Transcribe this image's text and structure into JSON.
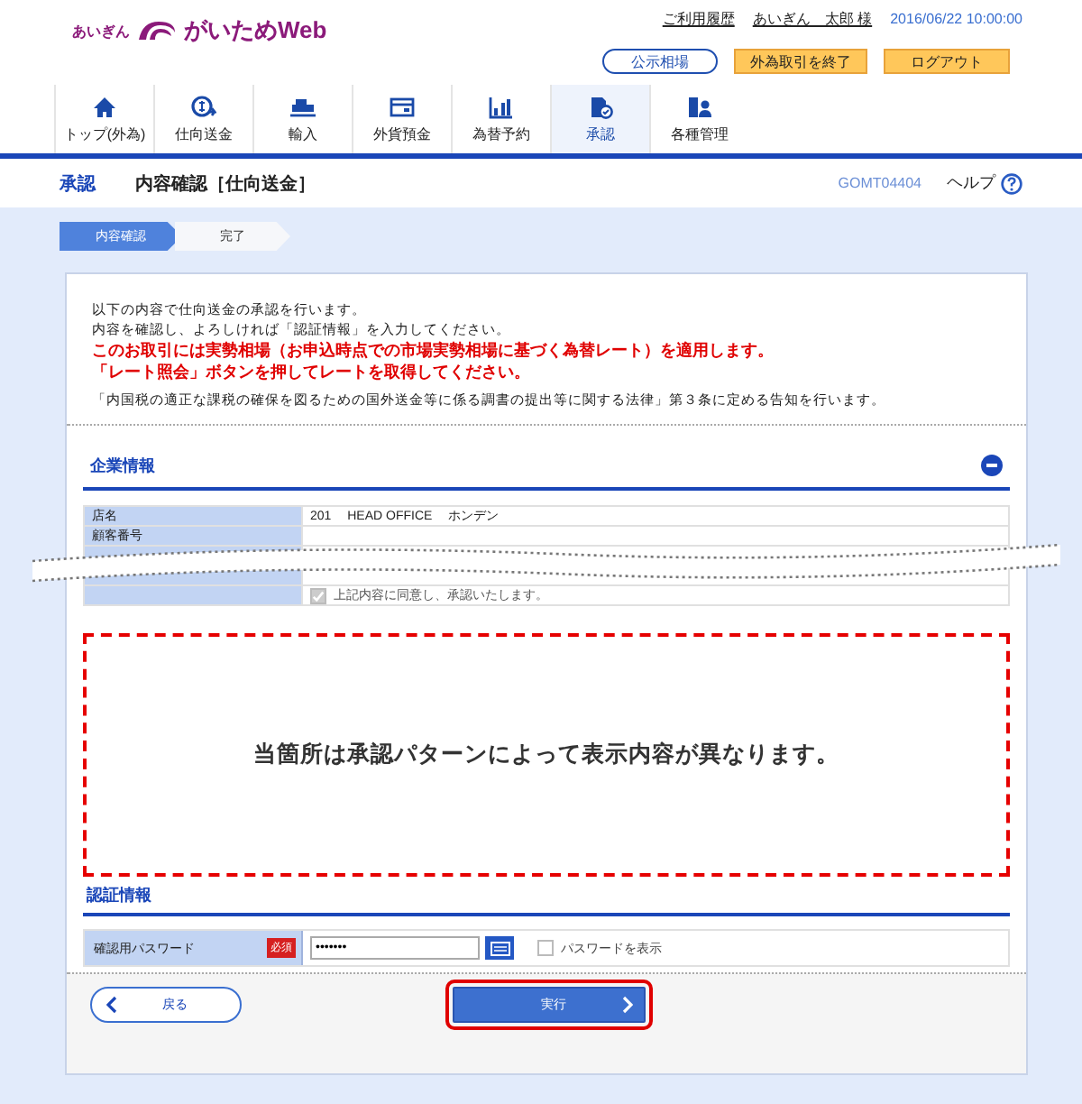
{
  "header": {
    "logo_small": "あいぎん",
    "logo": "がいためWeb",
    "links": [
      "ご利用履歴",
      "あいぎん　太郎 様"
    ],
    "datetime": "2016/06/22 10:00:00",
    "buttons": [
      {
        "label": "公示相場",
        "kind": "outline"
      },
      {
        "label": "外為取引を終了",
        "kind": "orange"
      },
      {
        "label": "ログアウト",
        "kind": "orange"
      }
    ]
  },
  "nav": [
    {
      "label": "トップ(外為)",
      "kind": "home",
      "selected": false
    },
    {
      "label": "仕向送金",
      "kind": "remit",
      "selected": false
    },
    {
      "label": "輸入",
      "kind": "ship",
      "selected": false
    },
    {
      "label": "外貨預金",
      "kind": "card",
      "selected": false
    },
    {
      "label": "為替予約",
      "kind": "chart",
      "selected": false
    },
    {
      "label": "承認",
      "kind": "approve",
      "selected": true
    },
    {
      "label": "各種管理",
      "kind": "admin",
      "selected": false
    }
  ],
  "page_title": {
    "section": "承認",
    "title": "内容確認［仕向送金］",
    "code": "GOMT04404",
    "help": "ヘルプ"
  },
  "steps": [
    {
      "label": "内容確認",
      "selected": true
    },
    {
      "label": "完了",
      "selected": false
    }
  ],
  "intro": [
    "以下の内容で仕向送金の承認を行います。",
    "内容を確認し、よろしければ「認証情報」を入力してください。"
  ],
  "warnings": [
    "このお取引には実勢相場（お申込時点での市場実勢相場に基づく為替レート）を適用します。",
    "「レート照会」ボタンを押してレートを取得してください。"
  ],
  "notice": "「内国税の適正な課税の確保を図るための国外送金等に係る調書の提出等に関する法律」第３条に定める告知を行います。",
  "company": {
    "title": "企業情報",
    "expanded": true,
    "rows": [
      {
        "label": "店名",
        "value": "201　 HEAD OFFICE　 ホンデン"
      },
      {
        "label": "顧客番号"
      }
    ],
    "agreement": {
      "label": "上記内容に同意し、承認いたします。",
      "checked": true
    }
  },
  "note": "当箇所は承認パターンによって表示内容が異なります。",
  "auth": {
    "title": "認証情報",
    "field_label": "確認用パスワード",
    "required": "必須",
    "value": "•••••••",
    "show_password": {
      "label": "パスワードを表示",
      "checked": false
    }
  },
  "actions": {
    "back": "戻る",
    "execute": "実行"
  }
}
